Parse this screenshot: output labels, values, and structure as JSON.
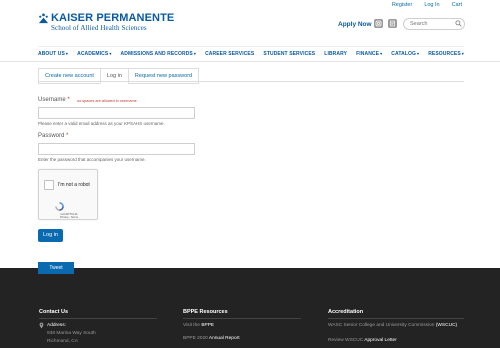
{
  "utility": {
    "register": "Register",
    "login": "Log In",
    "cart": "Cart"
  },
  "header": {
    "brand": "KAISER PERMANENTE",
    "subtitle": "School of Allied Health Sciences",
    "apply": "Apply Now",
    "search_placeholder": "Search"
  },
  "nav": [
    "ABOUT US",
    "ACADEMICS",
    "ADMISSIONS AND RECORDS",
    "CAREER SERVICES",
    "STUDENT SERVICES",
    "LIBRARY",
    "FINANCE",
    "CATALOG",
    "RESOURCES"
  ],
  "tabs": [
    "Create new account",
    "Log in",
    "Request new password"
  ],
  "form": {
    "username_label": "Username",
    "required_mark": "*",
    "username_error": "no spaces are allowed in username",
    "username_help": "Please enter a valid email address as your KPSAHS username.",
    "password_label": "Password",
    "password_help": "Enter the password that accompanies your username.",
    "captcha_text": "I'm not a robot",
    "captcha_brand": "reCAPTCHA",
    "captcha_links": "Privacy - Terms",
    "login_button": "Log in"
  },
  "footer": {
    "tweet_tab": "Tweet",
    "contact_head": "Contact Us",
    "address_label": "Address:",
    "address_line1": "938 Marina Way South",
    "address_line2": "Richmond, CA",
    "bppe_head": "BPPE Resources",
    "bppe_line1_pre": "Visit the",
    "bppe_line1_link": "BPPE",
    "bppe_line2_pre": "BPPE 2020",
    "bppe_line2_link": "Annual Report",
    "accred_head": "Accreditation",
    "accred_line1_pre": "WASC Senior College and University Commission",
    "accred_line1_link": "(WSCUC)",
    "accred_line2_pre": "Review WSCUC",
    "accred_line2_link": "Approval Letter"
  },
  "colors": {
    "brand": "#0a5aa0",
    "button": "#0a6ab0",
    "footer": "#232323",
    "error": "#c0392b"
  },
  "icons": [
    "logo-icon",
    "instagram-icon",
    "blog-icon",
    "search-icon",
    "chevron-down-icon",
    "recaptcha-icon",
    "map-pin-icon"
  ]
}
